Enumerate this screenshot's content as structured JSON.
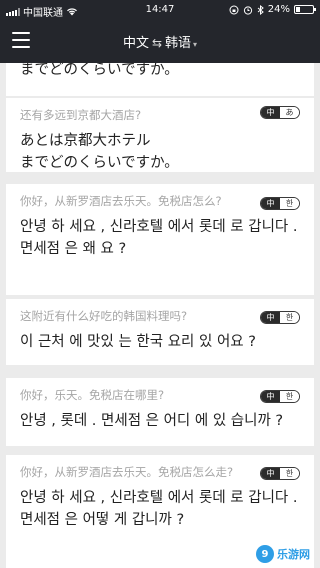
{
  "status_bar": {
    "carrier": "中国联通",
    "time": "14:47",
    "battery": "24%",
    "battery_level": 0.24
  },
  "header": {
    "source_lang": "中文",
    "swap_symbol": "⇆",
    "target_lang": "韩语",
    "caret": "▾"
  },
  "cards": [
    {
      "source": "",
      "target": "までどのくらいですか。",
      "badge_left": "",
      "badge_right": ""
    },
    {
      "source": "还有多远到京都大酒店?",
      "target": "あとは京都大ホテル\nまでどのくらいですか。",
      "badge_left": "中",
      "badge_right": "あ"
    },
    {
      "source": "你好，从新罗酒店去乐天。免税店怎么?",
      "target": "안녕 하 세요 , 신라호텔 에서 롯데 로 갑니다 . 면세점 은 왜 요 ?",
      "badge_left": "中",
      "badge_right": "한"
    },
    {
      "source": "这附近有什么好吃的韩国料理吗?",
      "target": "이 근처 에 맛있 는 한국 요리 있 어요 ?",
      "badge_left": "中",
      "badge_right": "한"
    },
    {
      "source": "你好，乐天。免税店在哪里?",
      "target": "안녕 , 롯데 . 면세점 은 어디 에 있 습니까 ?",
      "badge_left": "中",
      "badge_right": "한"
    },
    {
      "source": "你好，从新罗酒店去乐天。免税店怎么走?",
      "target": "안녕 하 세요 , 신라호텔 에서 롯데 로 갑니다 . 면세점 은 어떻 게 갑니까 ?",
      "badge_left": "中",
      "badge_right": "한"
    }
  ],
  "watermark": {
    "logo": "9",
    "text": "乐游网"
  }
}
